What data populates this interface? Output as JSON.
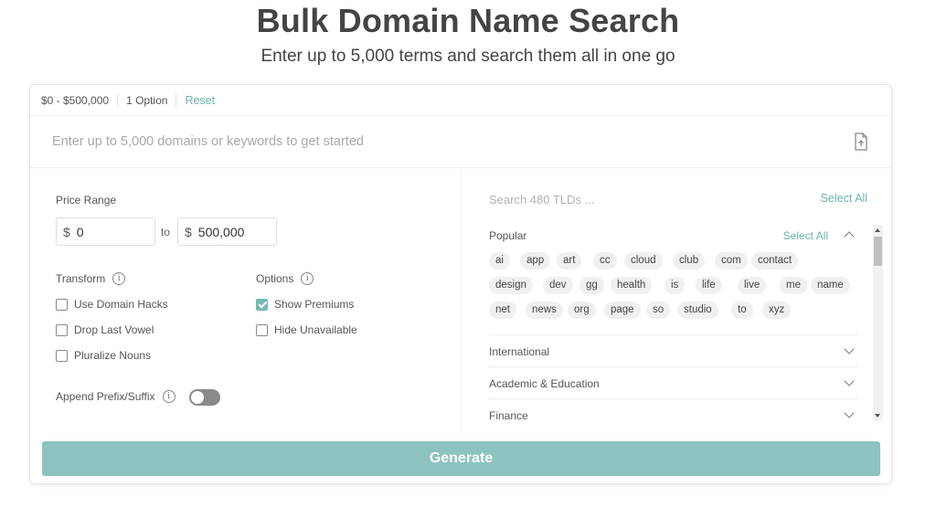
{
  "header": {
    "title": "Bulk Domain Name Search",
    "subtitle": "Enter up to 5,000 terms and search them all in one go"
  },
  "filters": {
    "price_chip": "$0 - $500,000",
    "option_chip": "1 Option",
    "reset_label": "Reset"
  },
  "search": {
    "placeholder": "Enter up to 5,000 domains or keywords to get started",
    "upload_icon": "upload-file-icon"
  },
  "price_range": {
    "label": "Price Range",
    "currency": "$",
    "min_value": "0",
    "to_label": "to",
    "max_value": "500,000"
  },
  "transform": {
    "label": "Transform",
    "items": [
      {
        "label": "Use Domain Hacks",
        "checked": false
      },
      {
        "label": "Drop Last Vowel",
        "checked": false
      },
      {
        "label": "Pluralize Nouns",
        "checked": false
      }
    ]
  },
  "options": {
    "label": "Options",
    "items": [
      {
        "label": "Show Premiums",
        "checked": true
      },
      {
        "label": "Hide Unavailable",
        "checked": false
      }
    ]
  },
  "append": {
    "label": "Append Prefix/Suffix",
    "enabled": false
  },
  "tlds": {
    "search_placeholder": "Search 480 TLDs ...",
    "select_all_label": "Select All",
    "popular": {
      "label": "Popular",
      "select_all_label": "Select All",
      "items": [
        "ai",
        "app",
        "art",
        "cc",
        "cloud",
        "club",
        "com",
        "contact",
        "design",
        "dev",
        "gg",
        "health",
        "is",
        "life",
        "live",
        "me",
        "name",
        "net",
        "news",
        "org",
        "page",
        "so",
        "studio",
        "to",
        "xyz"
      ]
    },
    "groups": [
      "International",
      "Academic & Education",
      "Finance"
    ]
  },
  "actions": {
    "generate_label": "Generate"
  },
  "colors": {
    "accent": "#6bb3ad",
    "generate_bg": "#8cc3bf",
    "checkbox_checked": "#76b9b3",
    "toggle_off": "#8a8a8a"
  }
}
